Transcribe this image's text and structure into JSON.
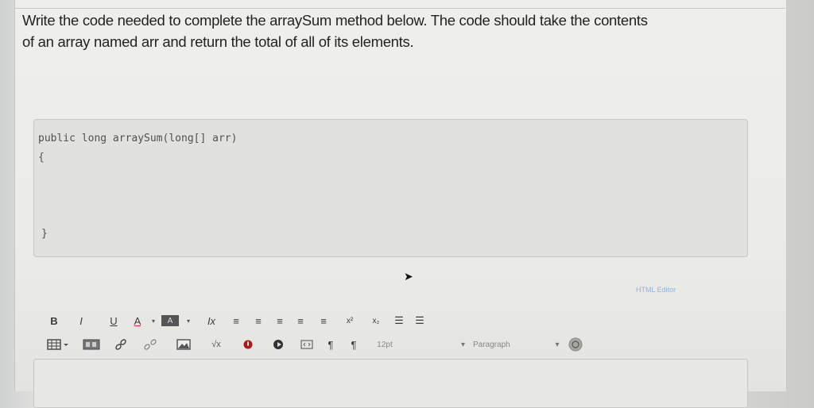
{
  "question": {
    "line1": "Write the code needed to complete the arraySum method below. The code should take the contents",
    "line2": "of an array named arr and return the total of all of its elements."
  },
  "code": {
    "signature": "public long arraySum(long[] arr)",
    "open_brace": "{",
    "close_brace": "}"
  },
  "editor": {
    "html_editor_label": "HTML Editor",
    "font_size": "12pt",
    "paragraph": "Paragraph",
    "toolbar_row1": [
      "B",
      "I",
      "U",
      "A",
      "▾",
      "A",
      "▾",
      "Ix",
      "≡",
      "≡",
      "≡",
      "≡",
      "≡",
      "x²",
      "x₂",
      "☰",
      "☰"
    ],
    "toolbar_row2_icons": [
      "table-icon",
      "embed-icon",
      "link-icon",
      "unlink-icon",
      "image-icon",
      "formula-icon",
      "record-icon",
      "media-icon",
      "html-icon",
      "ltr-icon",
      "rtl-icon"
    ]
  },
  "colors": {
    "link": "#8fb3d9",
    "text": "#232323"
  }
}
